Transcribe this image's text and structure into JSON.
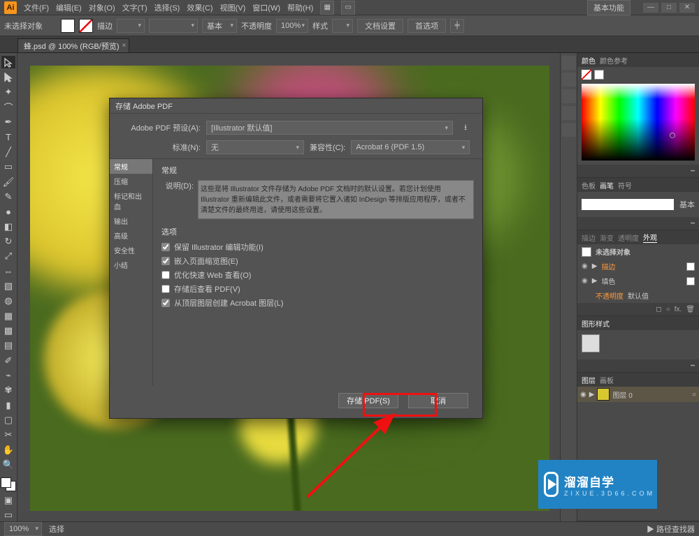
{
  "app": {
    "logo_text": "Ai"
  },
  "menu": {
    "items": [
      "文件(F)",
      "编辑(E)",
      "对象(O)",
      "文字(T)",
      "选择(S)",
      "效果(C)",
      "视图(V)",
      "窗口(W)",
      "帮助(H)"
    ],
    "workspace": "基本功能"
  },
  "optionbar": {
    "no_selection": "未选择对象",
    "stroke_label": "描边",
    "stroke_dd": "",
    "style_dd": "基本",
    "opacity_label": "不透明度",
    "opacity_value": "100%",
    "style_label": "样式",
    "docsetup": "文档设置",
    "prefs": "首选项"
  },
  "doc": {
    "tab": "蜂.psd @ 100% (RGB/预览)"
  },
  "dialog": {
    "title": "存储 Adobe PDF",
    "preset_label": "Adobe PDF 预设(A):",
    "preset_value": "[Illustrator 默认值]",
    "standard_label": "标准(N):",
    "standard_value": "无",
    "compat_label": "兼容性(C):",
    "compat_value": "Acrobat 6 (PDF 1.5)",
    "categories": [
      "常规",
      "压缩",
      "标记和出血",
      "输出",
      "高级",
      "安全性",
      "小结"
    ],
    "section_title": "常规",
    "desc_label": "说明(D):",
    "desc_text": "这些是将 Illustrator 文件存储为 Adobe PDF 文档时的默认设置。若您计划使用 Illustrator 重新编辑此文件，或者需要将它置入诸如 InDesign 等排版应用程序，或者不清楚文件的最终用途，请使用这些设置。",
    "options_title": "选项",
    "options": [
      {
        "label": "保留 Illustrator 编辑功能(I)",
        "checked": true
      },
      {
        "label": "嵌入页面缩览图(E)",
        "checked": true
      },
      {
        "label": "优化快速 Web 查看(O)",
        "checked": false
      },
      {
        "label": "存储后查看 PDF(V)",
        "checked": false
      },
      {
        "label": "从顶层图层创建 Acrobat 图层(L)",
        "checked": true
      }
    ],
    "save_btn": "存储 PDF(S)",
    "cancel_btn": "取消"
  },
  "panels": {
    "color": {
      "tabs": [
        "颜色",
        "颜色参考"
      ]
    },
    "swatches": {
      "tabs": [
        "色板",
        "画笔",
        "符号"
      ]
    },
    "stroke": {
      "label": "基本"
    },
    "appearance": {
      "tabs": [
        "描边",
        "渐变",
        "透明度",
        "外观"
      ],
      "title": "未选择对象",
      "rows": [
        {
          "icon": "▶",
          "label": "描边",
          "orange": true
        },
        {
          "icon": "▶",
          "label": "填色",
          "orange": false
        }
      ],
      "opacity_label": "不透明度",
      "opacity_value": "默认值"
    },
    "gstyle": {
      "tab": "图形样式"
    },
    "layers": {
      "tabs": [
        "图层",
        "画板"
      ],
      "row": "图层 0"
    }
  },
  "status": {
    "zoom": "100%",
    "tool": "选择",
    "nav": "▶ 路径查找器"
  },
  "watermark": {
    "big": "溜溜自学",
    "small": "ZIXUE.3D66.COM"
  }
}
